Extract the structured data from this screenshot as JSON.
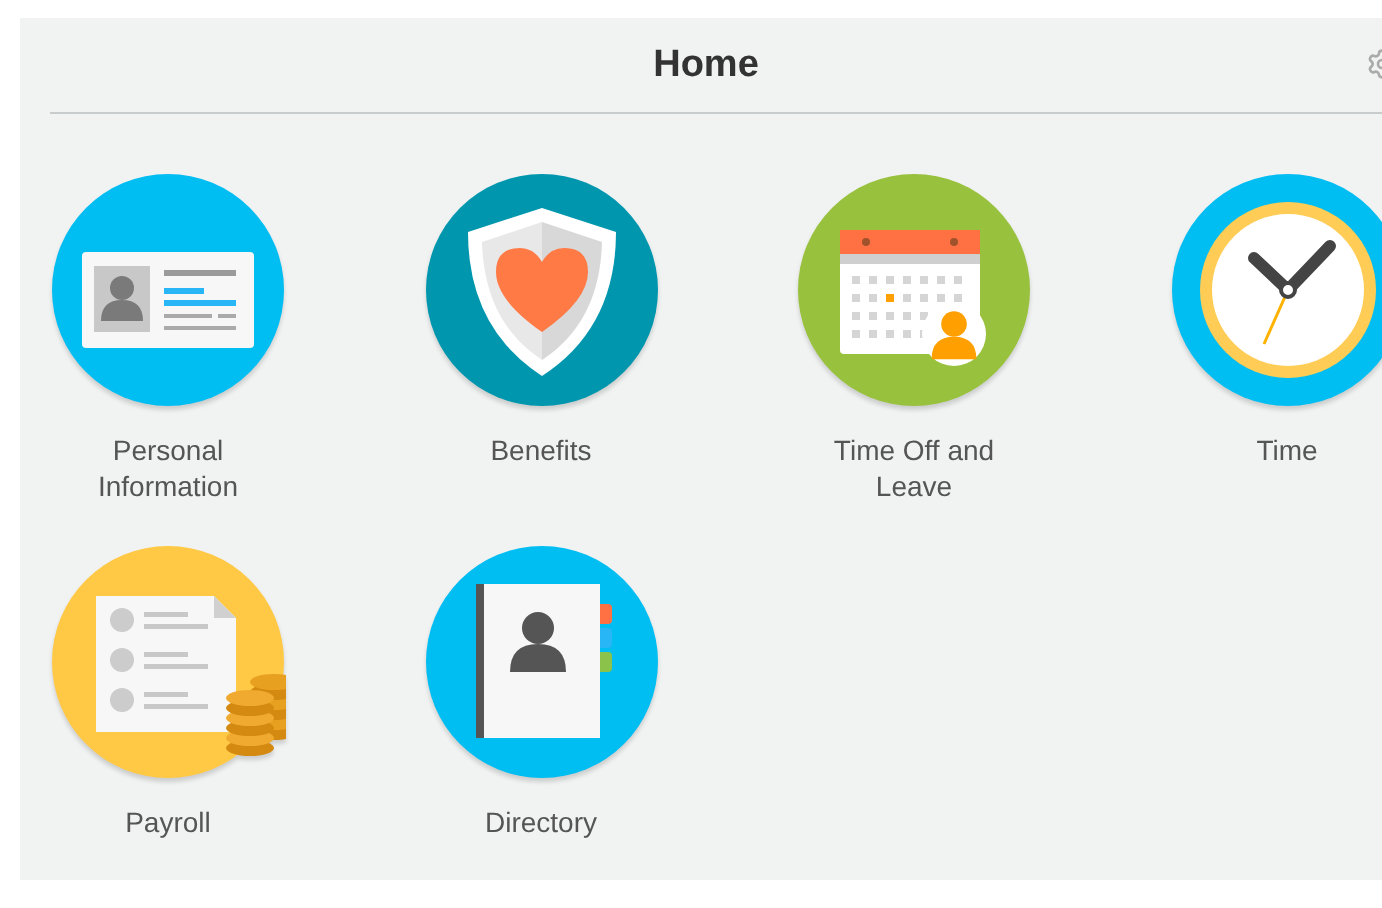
{
  "header": {
    "title": "Home"
  },
  "tiles": [
    {
      "label": "Personal Information",
      "kind": "card"
    },
    {
      "label": "Benefits",
      "kind": "shield"
    },
    {
      "label": "Time Off and Leave",
      "kind": "calendar"
    },
    {
      "label": "Time",
      "kind": "clock"
    },
    {
      "label": "Payroll",
      "kind": "payroll"
    },
    {
      "label": "Directory",
      "kind": "directory"
    }
  ]
}
